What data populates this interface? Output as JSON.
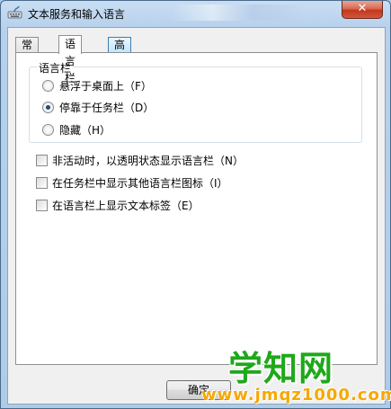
{
  "window": {
    "title": "文本服务和输入语言",
    "close_label": "✕"
  },
  "tabs": [
    {
      "label": "常规"
    },
    {
      "label": "语言栏"
    },
    {
      "label": "高级键设置"
    }
  ],
  "language_bar_group": {
    "label": "语言栏",
    "options": [
      {
        "label": "悬浮于桌面上（F）",
        "selected": false
      },
      {
        "label": "停靠于任务栏（D）",
        "selected": true
      },
      {
        "label": "隐藏（H）",
        "selected": false
      }
    ]
  },
  "checkboxes": [
    {
      "label": "非活动时，以透明状态显示语言栏（N）",
      "checked": false
    },
    {
      "label": "在任务栏中显示其他语言栏图标（I）",
      "checked": false
    },
    {
      "label": "在语言栏上显示文本标签（E）",
      "checked": false
    }
  ],
  "buttons": {
    "ok_label": "确定"
  },
  "watermark": {
    "title": "学知网",
    "url": "www.jmqz1000.com"
  },
  "colors": {
    "watermark_green": "#1fa81a",
    "watermark_orange": "#f5a800",
    "close_red": "#c2381f"
  }
}
